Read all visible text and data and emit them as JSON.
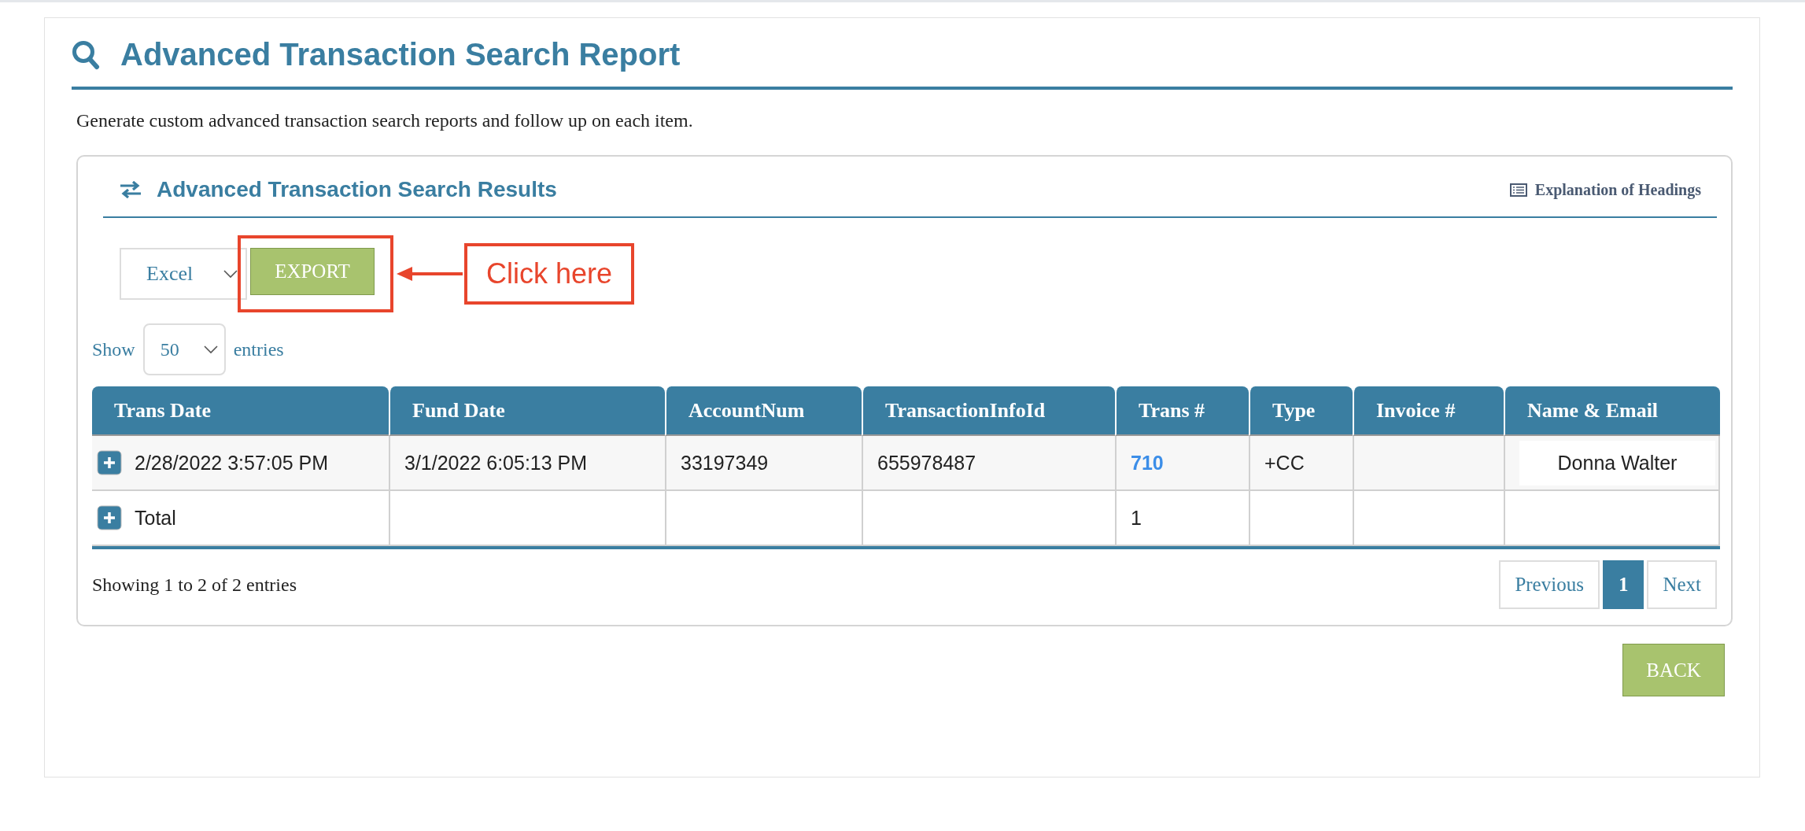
{
  "page": {
    "title": "Advanced Transaction Search Report",
    "description": "Generate custom advanced transaction search reports and follow up on each item."
  },
  "results": {
    "title": "Advanced Transaction Search Results",
    "headings_link": "Explanation of Headings",
    "export_format": "Excel",
    "export_button": "EXPORT",
    "callout": "Click here",
    "show_label": "Show",
    "page_size": "50",
    "entries_label": "entries",
    "table": {
      "columns": [
        "Trans Date",
        "Fund Date",
        "AccountNum",
        "TransactionInfoId",
        "Trans #",
        "Type",
        "Invoice #",
        "Name & Email"
      ],
      "rows": [
        {
          "cells": [
            {
              "text": "2/28/2022 3:57:05 PM",
              "kind": "text"
            },
            {
              "text": "3/1/2022 6:05:13 PM",
              "kind": "text"
            },
            {
              "text": "33197349",
              "kind": "text"
            },
            {
              "text": "655978487",
              "kind": "text"
            },
            {
              "text": "710",
              "kind": "link"
            },
            {
              "text": "+CC",
              "kind": "text"
            },
            null,
            {
              "text": "Donna Walter",
              "kind": "boxed"
            }
          ]
        },
        {
          "cells": [
            {
              "text": "Total",
              "kind": "text"
            },
            null,
            null,
            null,
            {
              "text": "1",
              "kind": "text"
            },
            null,
            null,
            null
          ]
        }
      ]
    },
    "info": "Showing 1 to 2 of 2 entries",
    "pagination": [
      {
        "label": "Previous",
        "selected": false
      },
      {
        "label": "1",
        "selected": true
      },
      {
        "label": "Next",
        "selected": false
      }
    ]
  },
  "back_button": "BACK"
}
